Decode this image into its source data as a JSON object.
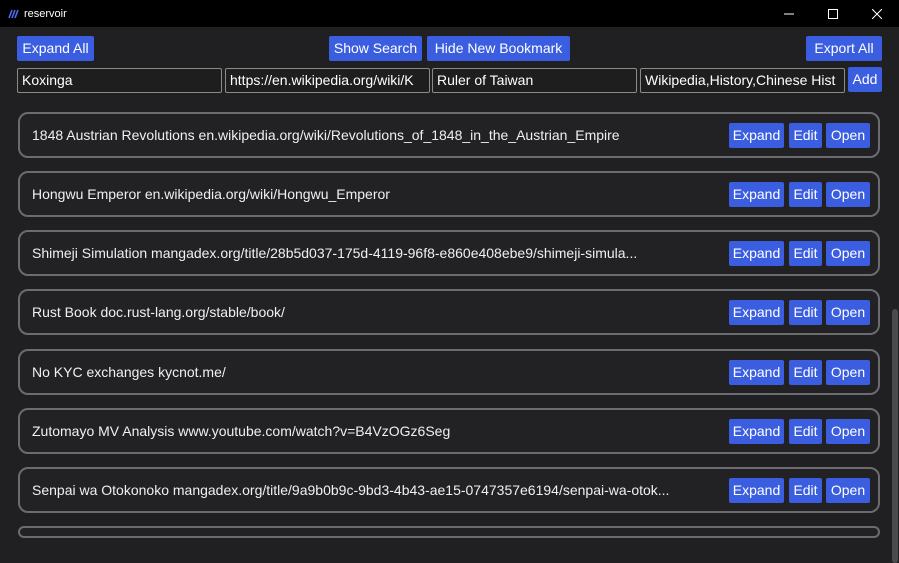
{
  "window": {
    "title": "reservoir"
  },
  "toolbar": {
    "expand_all": "Expand All",
    "show_search": "Show Search",
    "hide_new_bookmark": "Hide New Bookmark",
    "export_all": "Export All"
  },
  "new_bookmark": {
    "name_value": "Koxinga",
    "url_value": "https://en.wikipedia.org/wiki/K",
    "description_value": "Ruler of Taiwan",
    "tags_value": "Wikipedia,History,Chinese Hist",
    "add_label": "Add"
  },
  "bookmarks": [
    {
      "text": " 1848 Austrian Revolutions  en.wikipedia.org/wiki/Revolutions_of_1848_in_the_Austrian_Empire",
      "expand": "Expand",
      "edit": "Edit",
      "open": "Open"
    },
    {
      "text": "Hongwu Emperor  en.wikipedia.org/wiki/Hongwu_Emperor",
      "expand": "Expand",
      "edit": "Edit",
      "open": "Open"
    },
    {
      "text": "Shimeji Simulation  mangadex.org/title/28b5d037-175d-4119-96f8-e860e408ebe9/shimeji-simula...",
      "expand": "Expand",
      "edit": "Edit",
      "open": "Open"
    },
    {
      "text": "Rust Book  doc.rust-lang.org/stable/book/",
      "expand": "Expand",
      "edit": "Edit",
      "open": "Open"
    },
    {
      "text": "No KYC exchanges  kycnot.me/",
      "expand": "Expand",
      "edit": "Edit",
      "open": "Open"
    },
    {
      "text": "Zutomayo MV Analysis  www.youtube.com/watch?v=B4VzOGz6Seg",
      "expand": "Expand",
      "edit": "Edit",
      "open": "Open"
    },
    {
      "text": "Senpai wa Otokonoko  mangadex.org/title/9a9b0b9c-9bd3-4b43-ae15-0747357e6194/senpai-wa-otok...",
      "expand": "Expand",
      "edit": "Edit",
      "open": "Open"
    }
  ],
  "icons": {
    "app": "reservoir-logo-icon",
    "minimize": "minimize-icon",
    "maximize": "maximize-icon",
    "close": "close-icon"
  },
  "colors": {
    "accent": "#3b5ee0",
    "background": "#202023",
    "card_border": "#6b6b70",
    "titlebar": "#000000"
  }
}
